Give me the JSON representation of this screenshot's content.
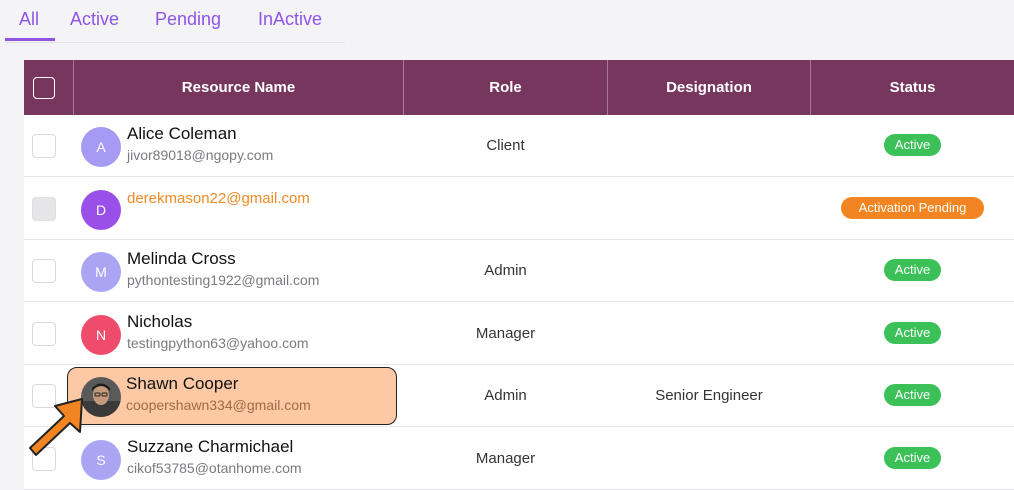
{
  "tabs": [
    {
      "label": "All",
      "active": true
    },
    {
      "label": "Active",
      "active": false
    },
    {
      "label": "Pending",
      "active": false
    },
    {
      "label": "InActive",
      "active": false
    }
  ],
  "columns": [
    "Resource Name",
    "Role",
    "Designation",
    "Status"
  ],
  "colors": {
    "accent": "#8e55e3",
    "header_bg": "#76365e",
    "active_badge": "#3cc159",
    "pending_badge": "#f28521",
    "highlight": "#fcc9a4"
  },
  "rows": [
    {
      "initial": "A",
      "name": "Alice Coleman",
      "email": "jivor89018@ngopy.com",
      "role": "Client",
      "designation": "",
      "status": "Active",
      "avatar_color": "#a79af5"
    },
    {
      "initial": "D",
      "name": "",
      "email": "derekmason22@gmail.com",
      "role": "",
      "designation": "",
      "status": "Activation Pending",
      "avatar_color": "#9a4fe8"
    },
    {
      "initial": "M",
      "name": "Melinda Cross",
      "email": "pythontesting1922@gmail.com",
      "role": "Admin",
      "designation": "",
      "status": "Active",
      "avatar_color": "#aaa4f2"
    },
    {
      "initial": "N",
      "name": "Nicholas",
      "email": "testingpython63@yahoo.com",
      "role": "Manager",
      "designation": "",
      "status": "Active",
      "avatar_color": "#ef4b6a"
    },
    {
      "initial": "",
      "name": "Shawn Cooper",
      "email": "coopershawn334@gmail.com",
      "role": "Admin",
      "designation": "Senior Engineer",
      "status": "Active",
      "avatar_color": "#555555"
    },
    {
      "initial": "S",
      "name": "Suzzane Charmichael",
      "email": "cikof53785@otanhome.com",
      "role": "Manager",
      "designation": "",
      "status": "Active",
      "avatar_color": "#aaa4f2"
    }
  ]
}
